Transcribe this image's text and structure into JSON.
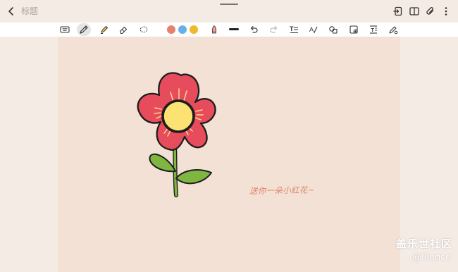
{
  "header": {
    "title": "标题"
  },
  "toolbar": {
    "colors": [
      "#e7806c",
      "#6ab0e8",
      "#f0b92c"
    ],
    "selected_tool": "pen"
  },
  "canvas": {
    "handwriting": "送你一朵小红花~"
  },
  "watermark": {
    "brand": "盖乐世社区",
    "author": "@lilence"
  }
}
